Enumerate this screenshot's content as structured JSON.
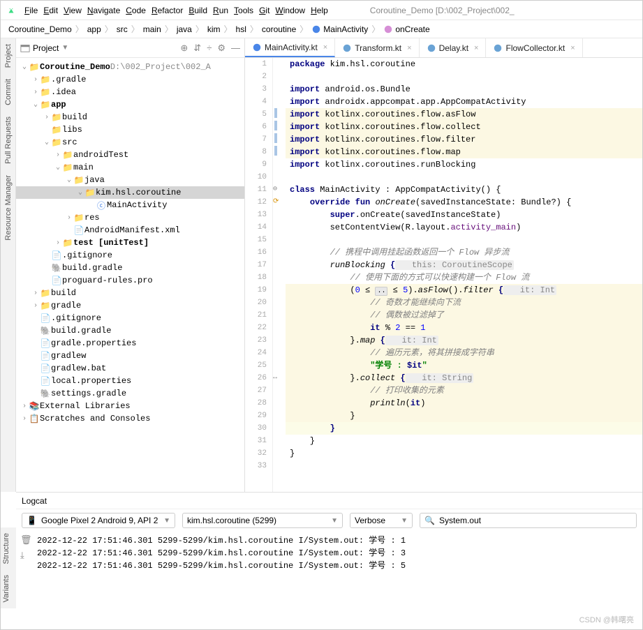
{
  "menubar": {
    "items": [
      "File",
      "Edit",
      "View",
      "Navigate",
      "Code",
      "Refactor",
      "Build",
      "Run",
      "Tools",
      "Git",
      "Window",
      "Help"
    ],
    "title_path": "Coroutine_Demo [D:\\002_Project\\002_"
  },
  "breadcrumb": {
    "items": [
      "Coroutine_Demo",
      "app",
      "src",
      "main",
      "java",
      "kim",
      "hsl",
      "coroutine",
      "MainActivity",
      "onCreate"
    ]
  },
  "project": {
    "label": "Project",
    "tree": [
      {
        "d": 0,
        "a": "v",
        "i": "proj",
        "t": "Coroutine_Demo",
        "suf": "D:\\002_Project\\002_A"
      },
      {
        "d": 1,
        "a": ">",
        "i": "fo",
        "t": ".gradle"
      },
      {
        "d": 1,
        "a": ">",
        "i": "fo",
        "t": ".idea"
      },
      {
        "d": 1,
        "a": "v",
        "i": "fb",
        "t": "app"
      },
      {
        "d": 2,
        "a": ">",
        "i": "fo",
        "t": "build"
      },
      {
        "d": 2,
        "a": "",
        "i": "fb",
        "t": "libs"
      },
      {
        "d": 2,
        "a": "v",
        "i": "fb",
        "t": "src"
      },
      {
        "d": 3,
        "a": ">",
        "i": "fb",
        "t": "androidTest"
      },
      {
        "d": 3,
        "a": "v",
        "i": "fb",
        "t": "main"
      },
      {
        "d": 4,
        "a": "v",
        "i": "fb",
        "t": "java"
      },
      {
        "d": 5,
        "a": "v",
        "i": "fb",
        "t": "kim.hsl.coroutine",
        "sel": true
      },
      {
        "d": 6,
        "a": "",
        "i": "kt",
        "t": "MainActivity"
      },
      {
        "d": 4,
        "a": ">",
        "i": "fb",
        "t": "res"
      },
      {
        "d": 4,
        "a": "",
        "i": "xml",
        "t": "AndroidManifest.xml"
      },
      {
        "d": 3,
        "a": ">",
        "i": "fb",
        "t": "test [unitTest]"
      },
      {
        "d": 2,
        "a": "",
        "i": "f",
        "t": ".gitignore"
      },
      {
        "d": 2,
        "a": "",
        "i": "gr",
        "t": "build.gradle"
      },
      {
        "d": 2,
        "a": "",
        "i": "f",
        "t": "proguard-rules.pro"
      },
      {
        "d": 1,
        "a": ">",
        "i": "fo",
        "t": "build"
      },
      {
        "d": 1,
        "a": ">",
        "i": "fb",
        "t": "gradle"
      },
      {
        "d": 1,
        "a": "",
        "i": "f",
        "t": ".gitignore"
      },
      {
        "d": 1,
        "a": "",
        "i": "gr",
        "t": "build.gradle"
      },
      {
        "d": 1,
        "a": "",
        "i": "f",
        "t": "gradle.properties"
      },
      {
        "d": 1,
        "a": "",
        "i": "f",
        "t": "gradlew"
      },
      {
        "d": 1,
        "a": "",
        "i": "f",
        "t": "gradlew.bat"
      },
      {
        "d": 1,
        "a": "",
        "i": "f",
        "t": "local.properties"
      },
      {
        "d": 1,
        "a": "",
        "i": "gr",
        "t": "settings.gradle"
      },
      {
        "d": 0,
        "a": ">",
        "i": "lib",
        "t": "External Libraries"
      },
      {
        "d": 0,
        "a": ">",
        "i": "scr",
        "t": "Scratches and Consoles"
      }
    ]
  },
  "left_tabs": [
    "Project",
    "Commit",
    "Pull Requests",
    "Resource Manager"
  ],
  "bottom_left_tabs": [
    "Structure",
    "Variants"
  ],
  "editor": {
    "tabs": [
      {
        "name": "MainActivity.kt",
        "icon": "kt",
        "active": true
      },
      {
        "name": "Transform.kt",
        "icon": "kt"
      },
      {
        "name": "Delay.kt",
        "icon": "kt"
      },
      {
        "name": "FlowCollector.kt",
        "icon": "kt"
      }
    ],
    "code": [
      {
        "n": 1,
        "c": [
          [
            "kw",
            "package "
          ],
          [
            "",
            "kim.hsl.coroutine"
          ]
        ]
      },
      {
        "n": 2,
        "c": [
          [
            "",
            ""
          ]
        ]
      },
      {
        "n": 3,
        "c": [
          [
            "kw",
            "import "
          ],
          [
            "",
            "android.os.Bundle"
          ]
        ]
      },
      {
        "n": 4,
        "c": [
          [
            "kw",
            "import "
          ],
          [
            "",
            "androidx.appcompat.app.AppCompatActivity"
          ]
        ]
      },
      {
        "n": 5,
        "hl": true,
        "c": [
          [
            "kw",
            "import "
          ],
          [
            "",
            "kotlinx.coroutines.flow.asFlow"
          ]
        ]
      },
      {
        "n": 6,
        "hl": true,
        "c": [
          [
            "kw",
            "import "
          ],
          [
            "",
            "kotlinx.coroutines.flow.collect"
          ]
        ]
      },
      {
        "n": 7,
        "hl": true,
        "c": [
          [
            "kw",
            "import "
          ],
          [
            "",
            "kotlinx.coroutines.flow.filter"
          ]
        ]
      },
      {
        "n": 8,
        "hl": true,
        "c": [
          [
            "kw",
            "import "
          ],
          [
            "",
            "kotlinx.coroutines.flow.map"
          ]
        ]
      },
      {
        "n": 9,
        "c": [
          [
            "kw",
            "import "
          ],
          [
            "",
            "kotlinx.coroutines.runBlocking"
          ]
        ]
      },
      {
        "n": 10,
        "c": [
          [
            "",
            ""
          ]
        ]
      },
      {
        "n": 11,
        "c": [
          [
            "kw",
            "class "
          ],
          [
            "",
            "MainActivity : AppCompatActivity() {"
          ]
        ]
      },
      {
        "n": 12,
        "c": [
          [
            "",
            "    "
          ],
          [
            "kw",
            "override fun "
          ],
          [
            "fn",
            "onCreate"
          ],
          [
            "",
            "(savedInstanceState: Bundle?) {"
          ]
        ]
      },
      {
        "n": 13,
        "c": [
          [
            "",
            "        "
          ],
          [
            "kw",
            "super"
          ],
          [
            "",
            ".onCreate(savedInstanceState)"
          ]
        ]
      },
      {
        "n": 14,
        "c": [
          [
            "",
            "        setContentView(R.layout."
          ],
          [
            "purple",
            "activity_main"
          ],
          [
            "",
            ")"
          ]
        ]
      },
      {
        "n": 15,
        "c": [
          [
            "",
            ""
          ]
        ]
      },
      {
        "n": 16,
        "c": [
          [
            "",
            "        "
          ],
          [
            "cmt",
            "// 携程中调用挂起函数返回一个 Flow 异步流"
          ]
        ]
      },
      {
        "n": 17,
        "c": [
          [
            "",
            "        "
          ],
          [
            "fn",
            "runBlocking"
          ],
          [
            "",
            " "
          ],
          [
            "kw",
            "{"
          ],
          [
            "hint",
            "   this: CoroutineScope"
          ]
        ]
      },
      {
        "n": 18,
        "c": [
          [
            "",
            "            "
          ],
          [
            "cmt",
            "// 使用下面的方式可以快速构建一个 Flow 流"
          ]
        ]
      },
      {
        "n": 19,
        "hl": true,
        "c": [
          [
            "",
            "            ("
          ],
          [
            "num",
            "0"
          ],
          [
            "",
            " ≤ "
          ],
          [
            "fold",
            ".."
          ],
          [
            "",
            " ≤ "
          ],
          [
            "num",
            "5"
          ],
          [
            "",
            ")."
          ],
          [
            "fn",
            "asFlow"
          ],
          [
            "",
            "()."
          ],
          [
            "fn",
            "filter"
          ],
          [
            "",
            " "
          ],
          [
            "kw",
            "{"
          ],
          [
            "hint",
            "   it: Int"
          ]
        ]
      },
      {
        "n": 20,
        "hl": true,
        "c": [
          [
            "",
            "                "
          ],
          [
            "cmt",
            "// 奇数才能继续向下流"
          ]
        ]
      },
      {
        "n": 21,
        "hl": true,
        "c": [
          [
            "",
            "                "
          ],
          [
            "cmt",
            "// 偶数被过滤掉了"
          ]
        ]
      },
      {
        "n": 22,
        "hl": true,
        "c": [
          [
            "",
            "                "
          ],
          [
            "kw",
            "it"
          ],
          [
            "",
            " % "
          ],
          [
            "num",
            "2"
          ],
          [
            "",
            " == "
          ],
          [
            "num",
            "1"
          ]
        ]
      },
      {
        "n": 23,
        "hl": true,
        "c": [
          [
            "",
            "            }."
          ],
          [
            "fn",
            "map"
          ],
          [
            "",
            " "
          ],
          [
            "kw",
            "{"
          ],
          [
            "hint",
            "   it: Int"
          ]
        ]
      },
      {
        "n": 24,
        "hl": true,
        "c": [
          [
            "",
            "                "
          ],
          [
            "cmt",
            "// 遍历元素，将其拼接成字符串"
          ]
        ]
      },
      {
        "n": 25,
        "hl": true,
        "c": [
          [
            "",
            "                "
          ],
          [
            "str",
            "\"学号 : "
          ],
          [
            "kw",
            "$it"
          ],
          [
            "str",
            "\""
          ]
        ]
      },
      {
        "n": 26,
        "hl": true,
        "c": [
          [
            "",
            "            }."
          ],
          [
            "fn",
            "collect"
          ],
          [
            "",
            " "
          ],
          [
            "kw",
            "{"
          ],
          [
            "hint",
            "   it: String"
          ]
        ]
      },
      {
        "n": 27,
        "hl": true,
        "c": [
          [
            "",
            "                "
          ],
          [
            "cmt",
            "// 打印收集的元素"
          ]
        ]
      },
      {
        "n": 28,
        "hl": true,
        "c": [
          [
            "",
            "                "
          ],
          [
            "fn",
            "println"
          ],
          [
            "",
            "("
          ],
          [
            "kw",
            "it"
          ],
          [
            "",
            ")"
          ]
        ]
      },
      {
        "n": 29,
        "hl": true,
        "c": [
          [
            "",
            "            }"
          ]
        ]
      },
      {
        "n": 30,
        "caret": true,
        "c": [
          [
            "",
            "        "
          ],
          [
            "kw",
            "}"
          ]
        ]
      },
      {
        "n": 31,
        "c": [
          [
            "",
            "    }"
          ]
        ]
      },
      {
        "n": 32,
        "c": [
          [
            "",
            "}"
          ]
        ]
      },
      {
        "n": 33,
        "c": [
          [
            "",
            ""
          ]
        ]
      }
    ]
  },
  "logcat": {
    "title": "Logcat",
    "device": "Google Pixel 2 Android 9, API 2",
    "package": "kim.hsl.coroutine (5299)",
    "level": "Verbose",
    "filter": "System.out",
    "lines": [
      "2022-12-22 17:51:46.301 5299-5299/kim.hsl.coroutine I/System.out: 学号 : 1",
      "2022-12-22 17:51:46.301 5299-5299/kim.hsl.coroutine I/System.out: 学号 : 3",
      "2022-12-22 17:51:46.301 5299-5299/kim.hsl.coroutine I/System.out: 学号 : 5"
    ]
  },
  "watermark": "CSDN @韩曙亮"
}
